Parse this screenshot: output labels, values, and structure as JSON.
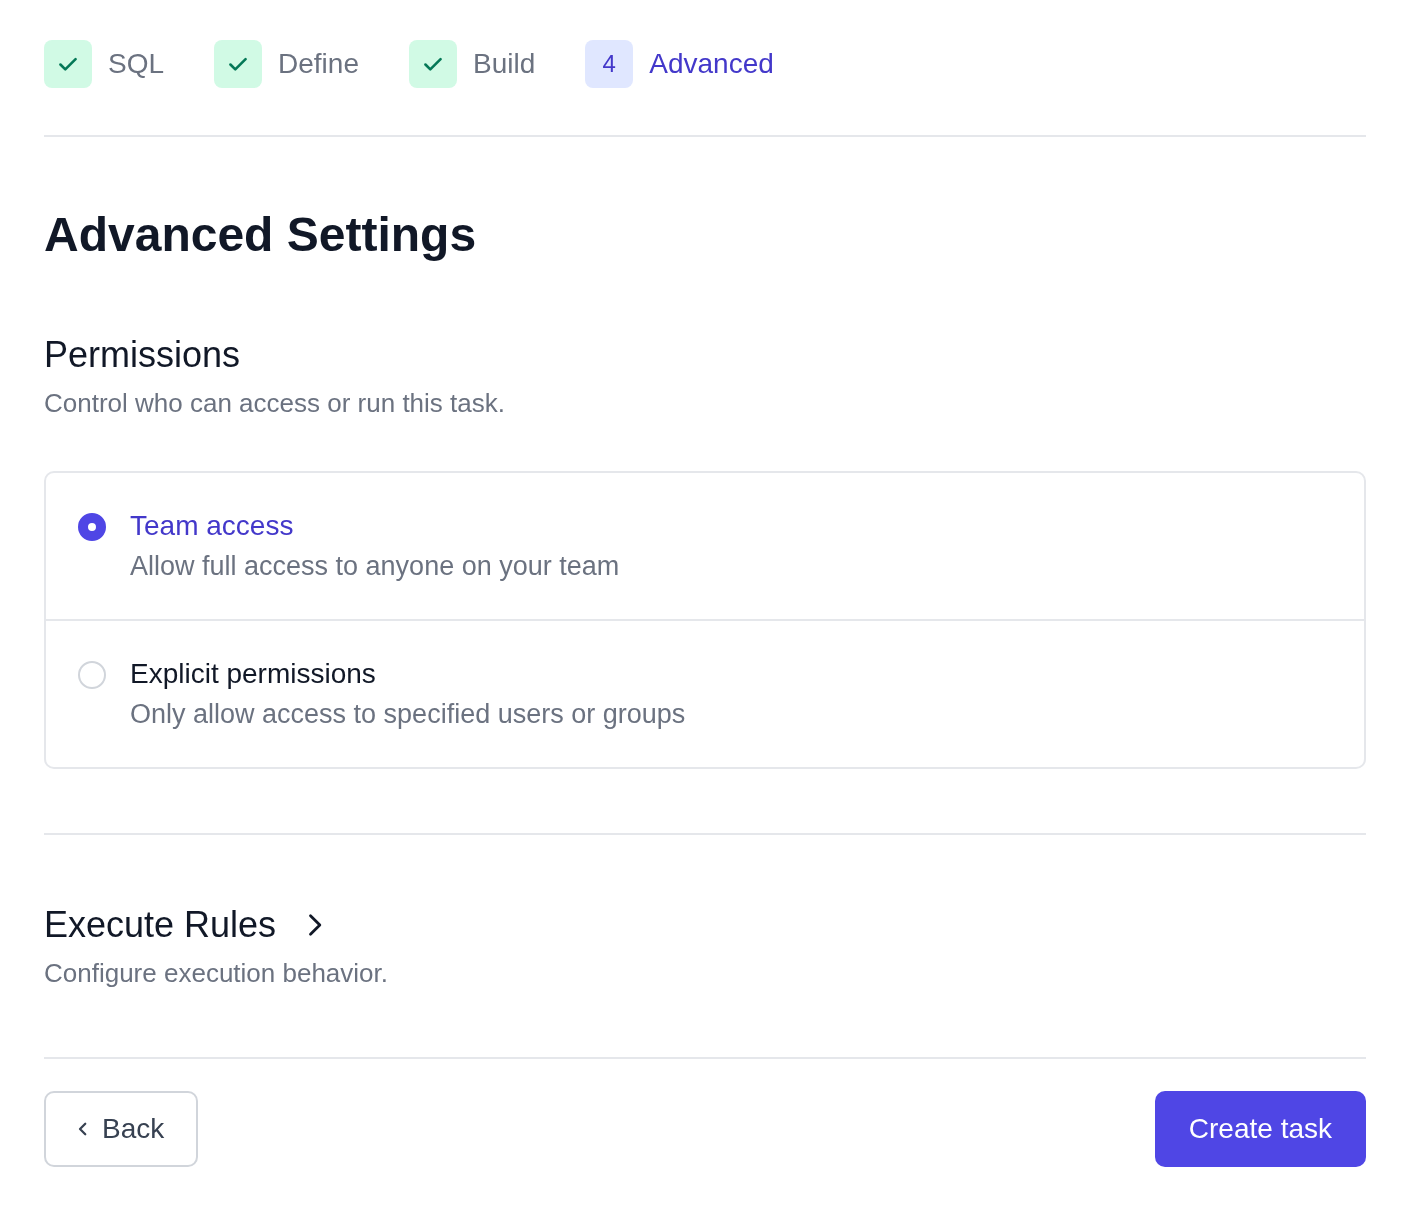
{
  "steps": [
    {
      "label": "SQL",
      "completed": true,
      "selected": false
    },
    {
      "label": "Define",
      "completed": true,
      "selected": false
    },
    {
      "label": "Build",
      "completed": true,
      "selected": false
    },
    {
      "label": "Advanced",
      "number": "4",
      "completed": false,
      "selected": true
    }
  ],
  "title": "Advanced Settings",
  "permissions": {
    "heading": "Permissions",
    "description": "Control who can access or run this task.",
    "options": [
      {
        "title": "Team access",
        "description": "Allow full access to anyone on your team",
        "selected": true
      },
      {
        "title": "Explicit permissions",
        "description": "Only allow access to specified users or groups",
        "selected": false
      }
    ]
  },
  "execute_rules": {
    "heading": "Execute Rules",
    "description": "Configure execution behavior.",
    "expanded": false
  },
  "buttons": {
    "back": "Back",
    "create": "Create task"
  }
}
